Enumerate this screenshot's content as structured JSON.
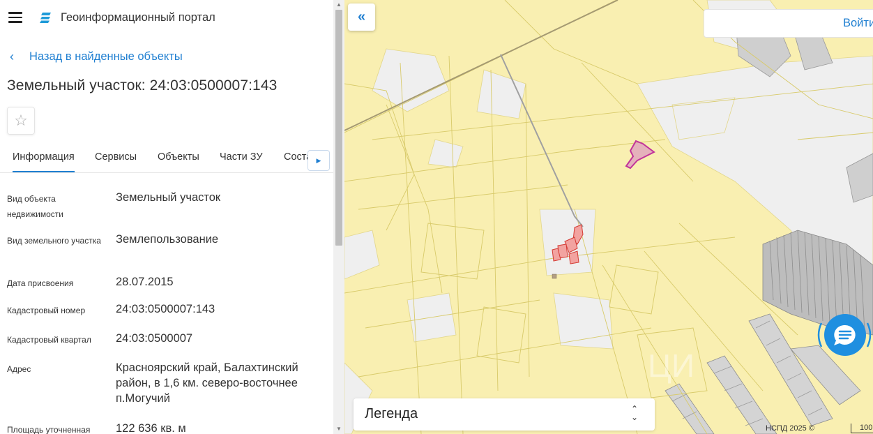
{
  "header": {
    "title": "Геоинформационный портал"
  },
  "back_link": "Назад в найденные объекты",
  "object_title": "Земельный участок: 24:03:0500007:143",
  "tabs": [
    {
      "label": "Информация",
      "active": true
    },
    {
      "label": "Сервисы"
    },
    {
      "label": "Объекты"
    },
    {
      "label": "Части ЗУ"
    },
    {
      "label": "Соста"
    }
  ],
  "info": [
    {
      "label": "Вид объекта недвижимости",
      "value": "Земельный участок"
    },
    {
      "label": "Вид земельного участка",
      "value": "Землепользование"
    },
    {
      "label": "Дата присвоения",
      "value": "28.07.2015"
    },
    {
      "label": "Кадастровый номер",
      "value": "24:03:0500007:143"
    },
    {
      "label": "Кадастровый квартал",
      "value": "24:03:0500007"
    },
    {
      "label": "Адрес",
      "value": "Красноярский край, Балахтинский район, в 1,6 км. северо-восточнее п.Могучий"
    },
    {
      "label": "Площадь уточненная",
      "value": "122 636 кв. м"
    }
  ],
  "map": {
    "login_label": "Войти",
    "legend_label": "Легенда",
    "copyright": "НСПД 2025 ©",
    "scale_label": "100"
  },
  "colors": {
    "accent": "#1f7fd1",
    "map_parcel": "#f9efb1",
    "map_empty": "#efefef",
    "selected_parcel": "#c2339a"
  }
}
